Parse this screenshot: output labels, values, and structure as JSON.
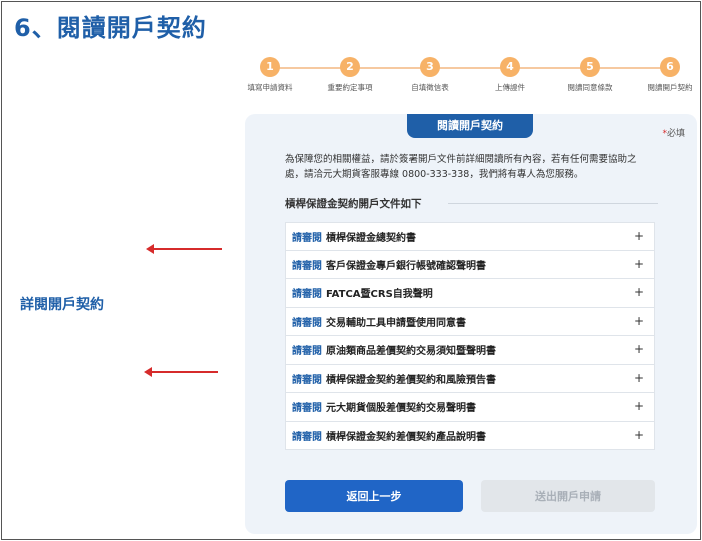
{
  "page": {
    "title": "6、閱讀開戶契約"
  },
  "stepper": {
    "steps": [
      {
        "num": "1",
        "label": "填寫申請資料"
      },
      {
        "num": "2",
        "label": "重要約定事項"
      },
      {
        "num": "3",
        "label": "自填徵信表"
      },
      {
        "num": "4",
        "label": "上傳證件"
      },
      {
        "num": "5",
        "label": "閱讀同意條款"
      },
      {
        "num": "6",
        "label": "閱讀開戶契約"
      }
    ],
    "color": "#f7b267"
  },
  "annotation": {
    "label": "詳閱開戶契約",
    "arrow_color": "#d62b2b"
  },
  "panel": {
    "tab_label": "閱讀開戶契約",
    "required_star": "*",
    "required_text": "必填",
    "intro": "為保障您的相關權益，請於簽署開戶文件前詳細閱讀所有內容，若有任何需要協助之處，請洽元大期貨客服專線 0800-333-338，我們將有專人為您服務。",
    "section_title": "槓桿保證金契約開戶文件如下",
    "read_label": "請審閱",
    "documents": [
      "槓桿保證金總契約書",
      "客戶保證金專戶銀行帳號確認聲明書",
      "FATCA暨CRS自我聲明",
      "交易輔助工具申請暨使用同意書",
      "原油類商品差價契約交易須知暨聲明書",
      "槓桿保證金契約差價契約和風險預告書",
      "元大期貨個股差價契約交易聲明書",
      "槓桿保證金契約差價契約產品說明書"
    ],
    "expand_icon": "+",
    "back_button": "返回上一步",
    "submit_button": "送出開戶申請",
    "accent_color": "#1f5fa8"
  }
}
